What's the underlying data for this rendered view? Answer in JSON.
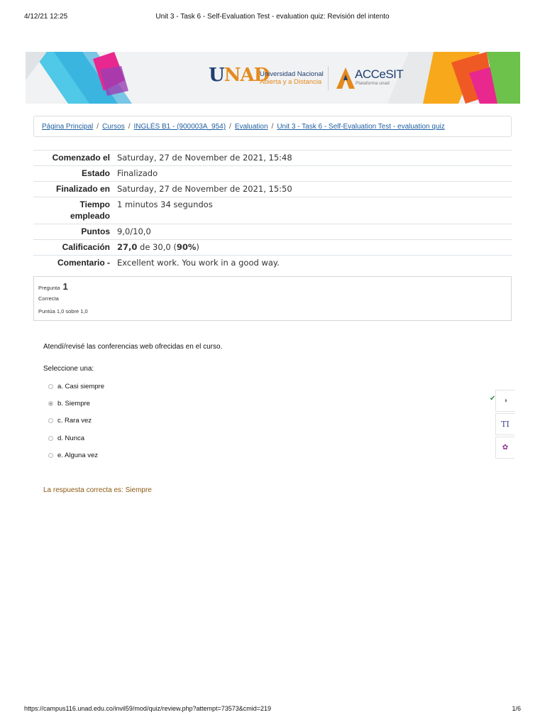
{
  "print_header": {
    "date": "4/12/21 12:25",
    "title": "Unit 3 - Task 6 - Self-Evaluation Test - evaluation quiz: Revisión del intento"
  },
  "banner": {
    "logo_u": "U",
    "logo_nad": "NAD",
    "uni_line1": "Universidad Nacional",
    "uni_line2": "Abierta y a Distancia",
    "accesit": "ACCeSIT",
    "accesit_sub": "Plataforma unad"
  },
  "breadcrumb": {
    "items": [
      "Página Principal",
      "Cursos",
      "INGLÉS B1 - (900003A_954)",
      "Evaluation",
      "Unit 3 - Task 6 - Self-Evaluation Test - evaluation quiz"
    ],
    "separator": "/"
  },
  "summary": {
    "started_label": "Comenzado el",
    "started_value": "Saturday, 27 de November de 2021, 15:48",
    "state_label": "Estado",
    "state_value": "Finalizado",
    "finished_label": "Finalizado en",
    "finished_value": "Saturday, 27 de November de 2021, 15:50",
    "time_label_1": "Tiempo",
    "time_label_2": "empleado",
    "time_value": "1 minutos 34 segundos",
    "points_label": "Puntos",
    "points_value": "9,0/10,0",
    "grade_label": "Calificación",
    "grade_score": "27,0",
    "grade_of": " de 30,0 (",
    "grade_pct": "90%",
    "grade_close": ")",
    "comment_label": "Comentario -",
    "comment_value": "Excellent work. You work in a good way."
  },
  "question": {
    "label": "Pregunta",
    "number": "1",
    "state": "Correcta",
    "grade": "Puntúa 1,0 sobre 1,0",
    "text": "Atendí/revisé las conferencias web ofrecidas en el curso.",
    "prompt": "Seleccione una:",
    "options": [
      "a. Casi siempre",
      "b. Siempre",
      "c. Rara vez",
      "d. Nunca",
      "e. Alguna vez"
    ],
    "selected_index": 1,
    "correct_answer": "La respuesta correcta es: Siempre"
  },
  "sidebar_icons": [
    "contrast-icon",
    "text-size-icon",
    "color-picker-icon"
  ],
  "sidebar_glyphs": {
    "contrast": "◑",
    "text": "TI",
    "color": "✿"
  },
  "check_glyph": "✔",
  "footer": {
    "url": "https://campus116.unad.edu.co/invil59/mod/quiz/review.php?attempt=73573&cmid=219",
    "page": "1/6"
  },
  "colors": {
    "link": "#1f5fa0",
    "unad_blue": "#1f3f73",
    "unad_orange": "#e48a1d",
    "feedback": "#8b5a12",
    "check": "#2e8b3e"
  }
}
